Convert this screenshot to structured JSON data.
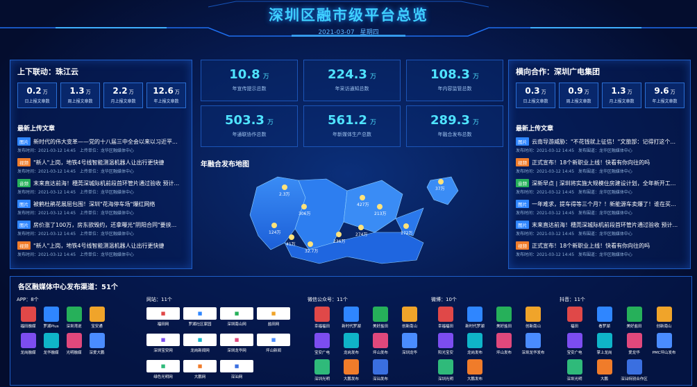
{
  "header": {
    "title": "深圳区融市级平台总览",
    "date": "2021-03-07",
    "weekday": "星期四"
  },
  "left": {
    "title": "上下联动：珠江云",
    "stats": [
      {
        "value": "0.2",
        "unit": "万",
        "label": "日上报文章数"
      },
      {
        "value": "1.3",
        "unit": "万",
        "label": "周上报文章数"
      },
      {
        "value": "2.2",
        "unit": "万",
        "label": "月上报文章数"
      },
      {
        "value": "12.6",
        "unit": "万",
        "label": "年上报文章数"
      }
    ],
    "section": "最新上传文章",
    "articles": [
      {
        "tag": "图片",
        "color": "#2f86ff",
        "title": "新时代的伟大变革——党的十八届三中全会以来以习近平...",
        "time": "发布时间：2021-03-12 14:45",
        "unit": "上传单位：龙华区融媒体中心"
      },
      {
        "tag": "视频",
        "color": "#f07c2a",
        "title": "\"新人\"上岗，地铁4号线智能测温机器人让出行更快捷",
        "time": "发布时间：2021-03-12 14:45",
        "unit": "上传单位：龙华区融媒体中心"
      },
      {
        "tag": "音频",
        "color": "#26b05a",
        "title": "末来直达前海！穗莞深城际机前段首环管片通过验收 预计...",
        "time": "发布时间：2021-03-12 14:45",
        "unit": "上传单位：龙华区融媒体中心"
      },
      {
        "tag": "图片",
        "color": "#2f86ff",
        "title": "被鹤杜鹃花展屈包围！深圳\"花海停车场\"爆红网络",
        "time": "发布时间：2021-03-12 14:45",
        "unit": "上传单位：龙华区融媒体中心"
      },
      {
        "tag": "图片",
        "color": "#2f86ff",
        "title": "房价涨了100万，房东欲毁约，还拿曝光\"阴阳合同\"要挟...",
        "time": "发布时间：2021-03-12 14:45",
        "unit": "上传单位：龙华区融媒体中心"
      },
      {
        "tag": "视频",
        "color": "#f07c2a",
        "title": "\"新人\"上岗，地铁4号线智能测温机器人让出行更快捷",
        "time": "发布时间：2021-03-12 14:45",
        "unit": "上传单位：龙华区融媒体中心"
      }
    ]
  },
  "right": {
    "title": "横向合作：深圳广电集团",
    "stats": [
      {
        "value": "0.3",
        "unit": "万",
        "label": "日上报文章数"
      },
      {
        "value": "0.9",
        "unit": "万",
        "label": "周上报文章数"
      },
      {
        "value": "1.3",
        "unit": "万",
        "label": "月上报文章数"
      },
      {
        "value": "9.6",
        "unit": "万",
        "label": "年上报文章数"
      }
    ],
    "section": "最新上传文章",
    "articles": [
      {
        "tag": "图片",
        "color": "#2f86ff",
        "title": "云南导游威胁：\"不花钱就上征信！\"文旅部：记得打这个...",
        "time": "发布时间：2021-03-12 14:45",
        "unit": "发布围道：龙华区融媒体中心"
      },
      {
        "tag": "视频",
        "color": "#f07c2a",
        "title": "正式宣布！18个新职业上线！快看有你向往的吗",
        "time": "发布时间：2021-03-12 14:45",
        "unit": "发布围道：龙华区融媒体中心"
      },
      {
        "tag": "音频",
        "color": "#26b05a",
        "title": "深新早点 | 深圳将实施大规模住房建设计划，全年新开工...",
        "time": "发布时间：2021-03-12 14:45",
        "unit": "发布围道：龙华区融媒体中心"
      },
      {
        "tag": "图片",
        "color": "#2f86ff",
        "title": "一年难求，提车得等三个月？！新能源车卖爆了！谁在买...",
        "time": "发布时间：2021-03-12 14:45",
        "unit": "发布围道：龙华区融媒体中心"
      },
      {
        "tag": "图片",
        "color": "#2f86ff",
        "title": "末来直达前海！穗莞深城际机前段首环管片通过验收 预计...",
        "time": "发布时间：2021-03-12 14:45",
        "unit": "发布围道：龙华区融媒体中心"
      },
      {
        "tag": "视频",
        "color": "#f07c2a",
        "title": "正式宣布！18个新职业上线！快看有你向往的吗",
        "time": "发布时间：2021-03-12 14:45",
        "unit": "发布围道：龙华区融媒体中心"
      }
    ]
  },
  "center": {
    "stats": [
      {
        "value": "10.8",
        "unit": "万",
        "label": "年宣传提示总数"
      },
      {
        "value": "224.3",
        "unit": "万",
        "label": "年采访通知总数"
      },
      {
        "value": "108.3",
        "unit": "万",
        "label": "年内容监管总数"
      },
      {
        "value": "503.3",
        "unit": "万",
        "label": "年通联协作总数"
      },
      {
        "value": "561.2",
        "unit": "万",
        "label": "年新媒体生产总数"
      },
      {
        "value": "289.3",
        "unit": "万",
        "label": "年融合发布总数"
      }
    ],
    "map_title": "年融合发布地图",
    "map_points": [
      "2.3万",
      "306万",
      "427万",
      "213万",
      "124万",
      "41万",
      "32.7万",
      "236万",
      "274万",
      "172万",
      "37万"
    ]
  },
  "channels": {
    "title": "各区融媒体中心发布渠道：51个",
    "app": {
      "label": "APP：8个",
      "items": [
        "福田融媒",
        "罗湖Plus",
        "深圳湾说",
        "宝安通",
        "龙岗融媒",
        "龙华融媒",
        "光明融媒",
        "深爱大鹏"
      ]
    },
    "web": {
      "label": "网站：11个",
      "items": [
        "福田网",
        "罗湖社区家园",
        "深圳南山网",
        "盐田网",
        "深圳宝安网",
        "龙岗新闻网",
        "深圳龙华网",
        "坪山新闻",
        "绿色光明网",
        "大鹏网",
        "深汕网"
      ]
    },
    "wechat": {
      "label": "微信公众号：11个",
      "items": [
        "幸福福田",
        "新时代罗湖",
        "美好盐田",
        "创新南山",
        "宝安广电",
        "龙岗发布",
        "坪山发布",
        "深圳龙华",
        "深圳光明",
        "大鹏发布",
        "深汕发布"
      ]
    },
    "weibo": {
      "label": "微博：10个",
      "items": [
        "幸福福田",
        "新时代罗湖",
        "美好盐田",
        "创新南山",
        "阳光宝安",
        "龙岗发布",
        "坪山发布",
        "深圳龙华发布",
        "深圳光明",
        "大鹏发布"
      ]
    },
    "douyin": {
      "label": "抖音：11个",
      "items": [
        "福田",
        "看罗湖",
        "美好盐田",
        "创新南山",
        "宝安广电",
        "掌上龙岗",
        "爱龙华",
        "PMC坪山发布",
        "深圳光明",
        "大鹏",
        "深汕特别合作区"
      ]
    }
  }
}
